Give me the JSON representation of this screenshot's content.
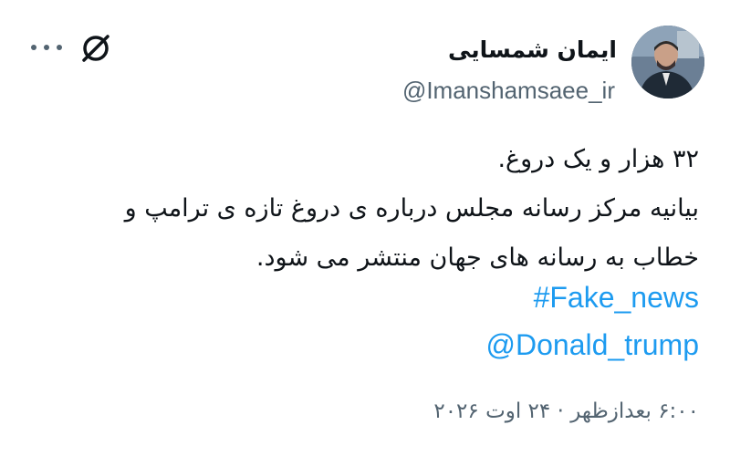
{
  "author": {
    "display_name": "ایمان شمسایی",
    "handle": "@Imanshamsaee_ir"
  },
  "header": {
    "more_icon": "more-horizontal-icon",
    "grok_icon": "grok-icon"
  },
  "tweet": {
    "lines": [
      "۳۲ هزار و یک دروغ.",
      "بیانیه مرکز رسانه مجلس درباره ی دروغ تازه ی ترامپ و",
      "خطاب به رسانه های جهان منتشر می شود."
    ],
    "hashtag": "#Fake_news",
    "mention": "@Donald_trump"
  },
  "timestamp": "۶:۰۰ بعدازظهر · ۲۴ اوت ۲۰۲۶",
  "colors": {
    "link": "#1d9bf0",
    "secondary_text": "#536471",
    "primary_text": "#0f1419"
  }
}
